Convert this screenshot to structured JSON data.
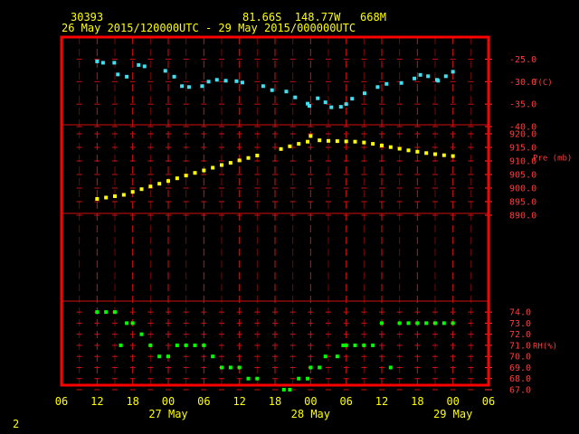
{
  "header": {
    "station_id": "30393",
    "location": "81.66S  148.77W   668M",
    "period": "26 May 2015/120000UTC - 29 May 2015/000000UTC"
  },
  "page_number": "2",
  "colors": {
    "frame": "#ff0000",
    "grid": "#d01010",
    "header_text": "#ffff00",
    "axis_text": "#ff3b3b",
    "temperature": "#40e0f0",
    "pressure": "#ffff00",
    "humidity": "#00ff00"
  },
  "chart_data": {
    "type": "scatter",
    "x_axis": {
      "unit": "hours since 26 May 2015 00 UTC",
      "range": [
        6,
        78
      ],
      "ticks": [
        {
          "x": 6,
          "label": "06"
        },
        {
          "x": 12,
          "label": "12"
        },
        {
          "x": 18,
          "label": "18"
        },
        {
          "x": 24,
          "label": "00"
        },
        {
          "x": 30,
          "label": "06"
        },
        {
          "x": 36,
          "label": "12"
        },
        {
          "x": 42,
          "label": "18"
        },
        {
          "x": 48,
          "label": "00"
        },
        {
          "x": 54,
          "label": "06"
        },
        {
          "x": 60,
          "label": "12"
        },
        {
          "x": 66,
          "label": "18"
        },
        {
          "x": 72,
          "label": "00"
        },
        {
          "x": 78,
          "label": "06"
        }
      ],
      "day_labels": [
        {
          "x": 24,
          "label": "27 May"
        },
        {
          "x": 48,
          "label": "28 May"
        },
        {
          "x": 72,
          "label": "29 May"
        }
      ]
    },
    "panels": [
      {
        "id": "temperature",
        "ylabel": "T(C)",
        "ylim": [
          -40,
          -22.5
        ],
        "ticks": [
          {
            "v": -25,
            "label": "-25.0"
          },
          {
            "v": -30,
            "label": "-30.0"
          },
          {
            "v": -35,
            "label": "-35.0"
          },
          {
            "v": -40,
            "label": "-40.0"
          }
        ],
        "color_key": "temperature",
        "series": [
          {
            "x": [
              12,
              13,
              14.9,
              15.5,
              17,
              19,
              20,
              23.5,
              25,
              26.3,
              27.5,
              29.7,
              30.8,
              32.2,
              33.7,
              35.5,
              36.5,
              40,
              41.5,
              43.9,
              45.4,
              47.5,
              47.8,
              49.2,
              50.5,
              51.5,
              53.1,
              54,
              55,
              57.1,
              59.3,
              60.8,
              63.3,
              65.5,
              66.5,
              67.8,
              69.3,
              69.5,
              70.8,
              72
            ],
            "y": [
              -25.5,
              -25.8,
              -25.8,
              -28.4,
              -28.9,
              -26.3,
              -26.6,
              -27.6,
              -28.9,
              -31,
              -31.2,
              -31,
              -30,
              -29.6,
              -29.8,
              -29.9,
              -30.2,
              -31,
              -31.9,
              -32.2,
              -33.5,
              -34.9,
              -35.4,
              -33.7,
              -34.6,
              -35.7,
              -35.6,
              -35,
              -33.8,
              -32.6,
              -31.2,
              -30.5,
              -30.3,
              -29.3,
              -28.5,
              -28.8,
              -29.6,
              -29.8,
              -28.8,
              -27.8
            ]
          }
        ]
      },
      {
        "id": "pressure",
        "ylabel": "Pre (mb)",
        "ylim": [
          890,
          922
        ],
        "ticks": [
          {
            "v": 920,
            "label": "920.0"
          },
          {
            "v": 915,
            "label": "915.0"
          },
          {
            "v": 910,
            "label": "910.0"
          },
          {
            "v": 905,
            "label": "905.0"
          },
          {
            "v": 900,
            "label": "900.0"
          },
          {
            "v": 895,
            "label": "895.0"
          },
          {
            "v": 890,
            "label": "890.0"
          }
        ],
        "color_key": "pressure",
        "series": [
          {
            "x": [
              12,
              13.5,
              15,
              16.5,
              18,
              19.5,
              21,
              22.5,
              24,
              25.5,
              27,
              28.5,
              30,
              31.5,
              33,
              34.5,
              36,
              37.5,
              39,
              43,
              44.5,
              46,
              47.5,
              48,
              49.5,
              51,
              52.5,
              54,
              55.5,
              57,
              58.5,
              60,
              61.5,
              63,
              64.5,
              66,
              67.5,
              69,
              70.5,
              72
            ],
            "y": [
              896,
              896.5,
              897,
              897.5,
              898.6,
              899.6,
              900.6,
              901.6,
              902.6,
              903.6,
              904.6,
              905.6,
              906.5,
              907.5,
              908.5,
              909.3,
              910.2,
              911.1,
              912,
              914.4,
              915.4,
              916.3,
              917.1,
              919.2,
              917.6,
              917.4,
              917.3,
              917.2,
              917.1,
              916.8,
              916.3,
              915.7,
              915.1,
              914.5,
              913.9,
              913.4,
              912.9,
              912.5,
              912.1,
              911.8
            ]
          }
        ]
      },
      {
        "id": "humidity",
        "ylabel": "RH(%)",
        "ylim": [
          67,
          74.5
        ],
        "ticks": [
          {
            "v": 74,
            "label": "74.0"
          },
          {
            "v": 73,
            "label": "73.0"
          },
          {
            "v": 72,
            "label": "72.0"
          },
          {
            "v": 71,
            "label": "71.0"
          },
          {
            "v": 70,
            "label": "70.0"
          },
          {
            "v": 69,
            "label": "69.0"
          },
          {
            "v": 68,
            "label": "68.0"
          },
          {
            "v": 67,
            "label": "67.0"
          }
        ],
        "color_key": "humidity",
        "series": [
          {
            "x": [
              12,
              13.5,
              15,
              16,
              17,
              18,
              19.5,
              21,
              22.5,
              24,
              25.5,
              27,
              28.5,
              30,
              31.5,
              33,
              34.5,
              36,
              37.5,
              39,
              43.5,
              44.5,
              46,
              47.5,
              48,
              49.5,
              50.5,
              52.5,
              53.5,
              54,
              55.5,
              57,
              58.5,
              60,
              61.5,
              63,
              64.5,
              66,
              67.5,
              69,
              70.5,
              72
            ],
            "y": [
              74,
              74,
              74,
              71,
              73,
              73,
              72,
              71,
              70,
              70,
              71,
              71,
              71,
              71,
              70,
              69,
              69,
              69,
              68,
              68,
              67,
              67,
              68,
              68,
              69,
              69,
              70,
              70,
              71,
              71,
              71,
              71,
              71,
              73,
              69,
              73,
              73,
              73,
              73,
              73,
              73,
              73
            ]
          }
        ]
      }
    ],
    "grid": true
  }
}
